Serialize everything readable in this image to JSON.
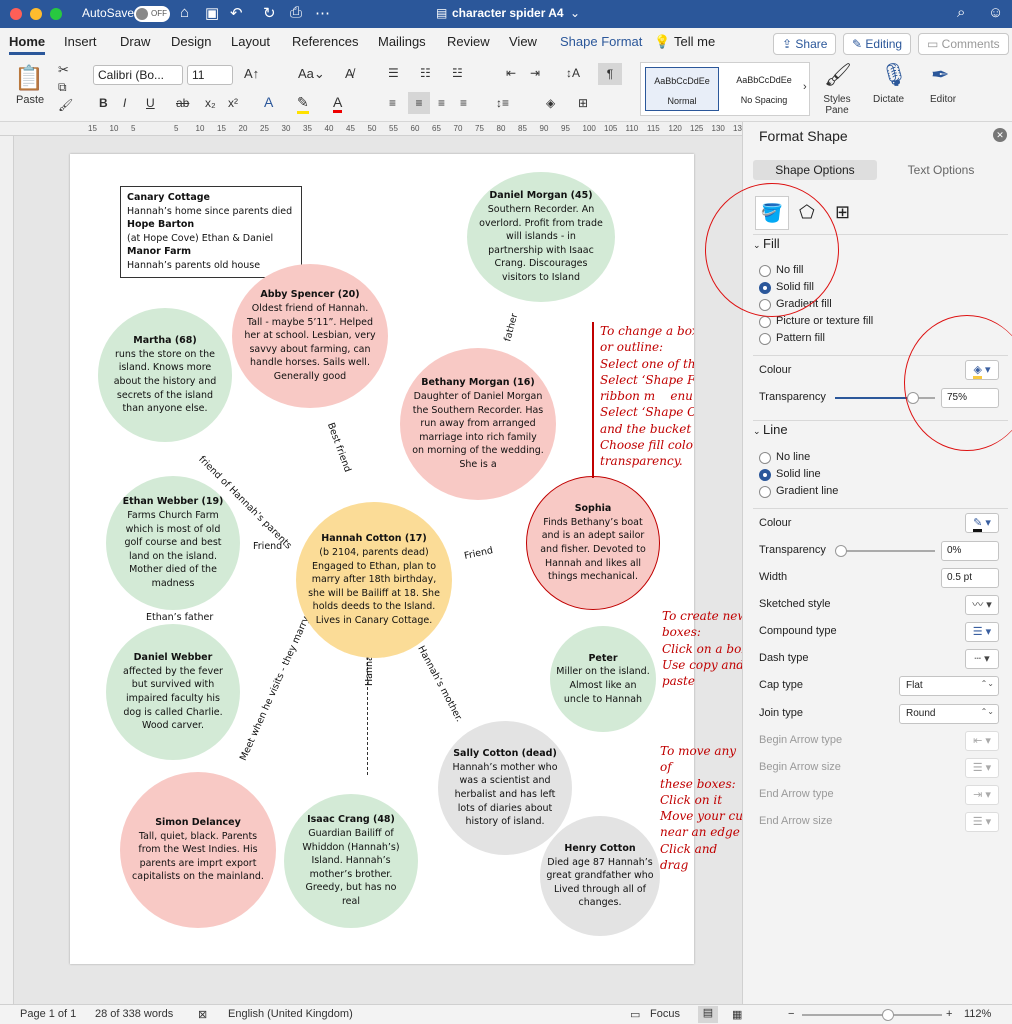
{
  "titlebar": {
    "autosave_label": "AutoSave",
    "autosave_state": "OFF",
    "document_title": "character spider A4",
    "title_chevron": "⌄"
  },
  "tabs": [
    "Home",
    "Insert",
    "Draw",
    "Design",
    "Layout",
    "References",
    "Mailings",
    "Review",
    "View",
    "Shape Format"
  ],
  "tell_me": "Tell me",
  "share_label": "Share",
  "editing_label": "Editing",
  "comments_label": "Comments",
  "ribbon": {
    "paste_label": "Paste",
    "font_name": "Calibri (Bo...",
    "font_size": "11",
    "styles": [
      {
        "preview": "AaBbCcDdEe",
        "name": "Normal"
      },
      {
        "preview": "AaBbCcDdEe",
        "name": "No Spacing"
      }
    ],
    "styles_pane_label": "Styles Pane",
    "dictate_label": "Dictate",
    "editor_label": "Editor"
  },
  "ruler_numbers": [
    "15",
    "10",
    "5",
    "",
    "5",
    "10",
    "15",
    "20",
    "25",
    "30",
    "35",
    "40",
    "45",
    "50",
    "55",
    "60",
    "65",
    "70",
    "75",
    "80",
    "85",
    "90",
    "95",
    "100",
    "105",
    "110",
    "115",
    "120",
    "125",
    "130",
    "135",
    "140"
  ],
  "document": {
    "key_box": [
      {
        "text": "Canary Cottage",
        "bold": true
      },
      {
        "text": "Hannah’s home since parents died",
        "bold": false
      },
      {
        "text": "Hope Barton",
        "bold": true
      },
      {
        "text": "(at Hope Cove) Ethan & Daniel",
        "bold": false
      },
      {
        "text": "Manor Farm",
        "bold": true
      },
      {
        "text": "Hannah’s parents old house",
        "bold": false
      }
    ],
    "characters": [
      {
        "id": "daniel-morgan",
        "name": "Daniel Morgan (45)",
        "desc": "Southern Recorder. An overlord. Profit from trade will islands - in partnership with Isaac Crang. Discourages visitors to Island",
        "color": "green"
      },
      {
        "id": "abby-spencer",
        "name": "Abby Spencer (20)",
        "desc": "Oldest friend of Hannah. Tall - maybe 5’11”. Helped her at school. Lesbian, very savvy about farming, can handle horses. Sails well. Generally good",
        "color": "pink"
      },
      {
        "id": "martha",
        "name": "Martha (68)",
        "desc": "runs the store on the island. Knows more about the history and secrets of the island than anyone else.",
        "color": "green"
      },
      {
        "id": "bethany-morgan",
        "name": "Bethany Morgan (16)",
        "desc": "Daughter of Daniel Morgan the Southern Recorder. Has run away from arranged marriage into rich family on morning of the wedding. She is a",
        "color": "pink"
      },
      {
        "id": "ethan-webber",
        "name": "Ethan Webber (19)",
        "desc": "Farms Church Farm which is most of old golf course and best land on the island. Mother died of the madness",
        "color": "green"
      },
      {
        "id": "hannah-cotton",
        "name": "Hannah Cotton (17)",
        "desc": "(b 2104, parents dead) Engaged to Ethan, plan to marry after 18th birthday, she will be Bailiff at 18. She holds deeds to the Island. Lives in Canary Cottage.",
        "color": "yellow"
      },
      {
        "id": "sophia",
        "name": "Sophia",
        "desc": "Finds Bethany’s boat and is an adept sailor and fisher. Devoted to Hannah and likes all things mechanical.",
        "color": "pink"
      },
      {
        "id": "daniel-webber",
        "name": "Daniel Webber",
        "desc": "affected by the fever but survived with impaired faculty his dog is called Charlie. Wood carver.",
        "color": "green"
      },
      {
        "id": "peter",
        "name": "Peter",
        "desc": "Miller on the island. Almost like an uncle to Hannah",
        "color": "green"
      },
      {
        "id": "sally-cotton",
        "name": "Sally Cotton (dead)",
        "desc": "Hannah’s mother who was a scientist and herbalist and has left lots of diaries about history of island.",
        "color": "grey"
      },
      {
        "id": "simon-delancey",
        "name": "Simon Delancey",
        "desc": "Tall, quiet, black. Parents from the West Indies. His parents are imprt export capitalists on the mainland.",
        "color": "pink"
      },
      {
        "id": "isaac-crang",
        "name": "Isaac Crang (48)",
        "desc": "Guardian Bailiff of Whiddon (Hannah’s) Island. Hannah’s mother’s brother. Greedy, but has no real",
        "color": "green"
      },
      {
        "id": "henry-cotton",
        "name": "Henry Cotton",
        "desc": "Died age 87 Hannah’s great grandfather who Lived through all of changes.",
        "color": "grey"
      }
    ],
    "connectors": {
      "father": "father",
      "best_friend": "Best friend",
      "friend_of_parents": "friend of Hannah’s parents",
      "friend_left": "Friend",
      "friend_right": "Friend",
      "ethans_father": "Ethan’s father",
      "meet_when_visits": "Meet when he visits - they marry",
      "hannahs_uncle": "Hannah’s uncle",
      "hannahs_mother": "Hannah’s mother."
    },
    "notes": {
      "change_colour": [
        "To change a box colour",
        "or outline:",
        "Select one of these boxes.",
        "Select ‘Shape Format’ in",
        "ribbon m    enu.",
        "Select ‘Shape Options’",
        "and the bucket icon.",
        "Choose fill colour &",
        "transparency."
      ],
      "create_boxes": [
        "To create new",
        "boxes:",
        "Click on a box",
        "Use copy and",
        "paste"
      ],
      "move_boxes": [
        "To move any of",
        "these boxes:",
        "Click on it",
        "Move your cursor",
        "near an edge",
        "Click and drag"
      ]
    }
  },
  "format_panel": {
    "title": "Format Shape",
    "tab_shape": "Shape Options",
    "tab_text": "Text Options",
    "fill_header": "Fill",
    "fill_options": [
      "No fill",
      "Solid fill",
      "Gradient fill",
      "Picture or texture fill",
      "Pattern fill"
    ],
    "fill_selected": "Solid fill",
    "fill_colour_label": "Colour",
    "fill_transparency_label": "Transparency",
    "fill_transparency_value": "75%",
    "line_header": "Line",
    "line_options": [
      "No line",
      "Solid line",
      "Gradient line"
    ],
    "line_selected": "Solid line",
    "line_colour_label": "Colour",
    "line_transparency_label": "Transparency",
    "line_transparency_value": "0%",
    "width_label": "Width",
    "width_value": "0.5 pt",
    "sketched_label": "Sketched style",
    "compound_label": "Compound type",
    "dash_label": "Dash type",
    "cap_label": "Cap type",
    "cap_value": "Flat",
    "join_label": "Join type",
    "join_value": "Round",
    "begin_arrow_type": "Begin Arrow type",
    "begin_arrow_size": "Begin Arrow size",
    "end_arrow_type": "End Arrow type",
    "end_arrow_size": "End Arrow size"
  },
  "status": {
    "page": "Page 1 of 1",
    "words": "28 of 338 words",
    "language": "English (United Kingdom)",
    "focus": "Focus",
    "zoom": "112%"
  },
  "colors": {
    "accent": "#2b579a",
    "red_annotation": "#c00000",
    "green": "#d3ead6",
    "pink": "#f8c9c5",
    "yellow": "#fbdc97",
    "grey": "#e3e3e3"
  }
}
